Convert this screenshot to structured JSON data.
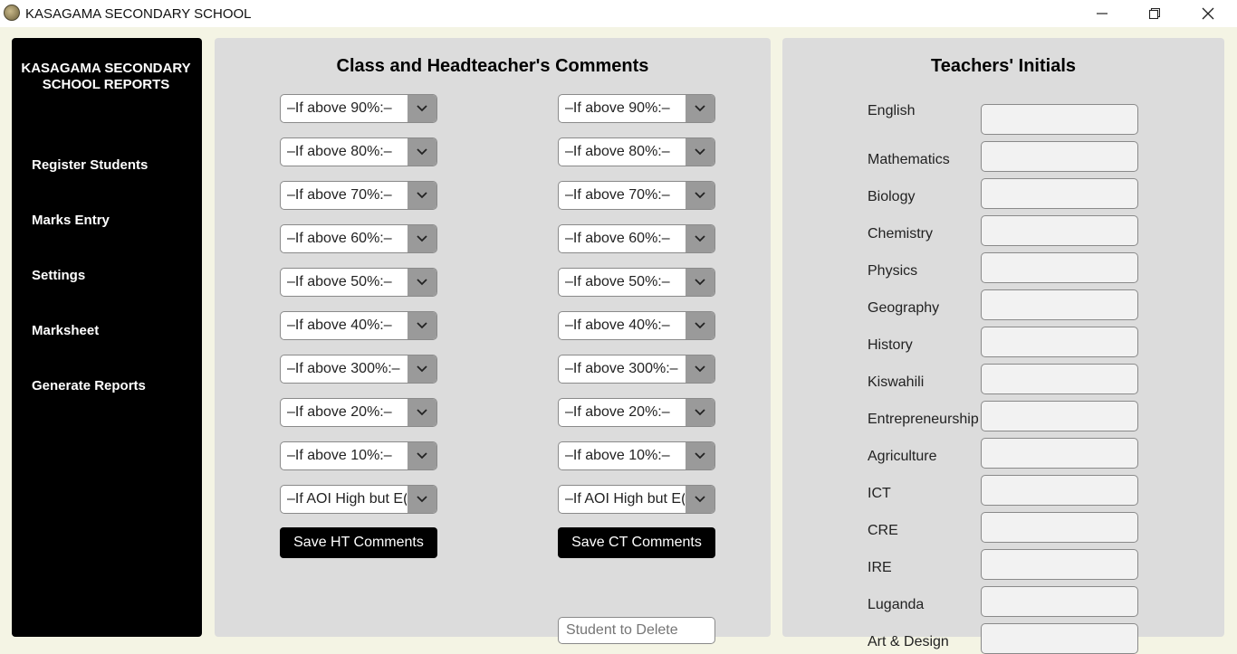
{
  "window": {
    "title": "KASAGAMA SECONDARY SCHOOL",
    "min_icon": "minimize-icon",
    "max_icon": "restore-icon",
    "close_icon": "close-icon"
  },
  "sidebar": {
    "school_name": "KASAGAMA SECONDARY SCHOOL REPORTS",
    "items": [
      {
        "label": "Register Students"
      },
      {
        "label": "Marks Entry"
      },
      {
        "label": "Settings"
      },
      {
        "label": "Marksheet"
      },
      {
        "label": "Generate Reports"
      }
    ]
  },
  "comments": {
    "title": "Class and Headteacher's Comments",
    "ht_column": [
      "–If above 90%:–",
      "–If above 80%:–",
      "–If above 70%:–",
      "–If above 60%:–",
      "–If above 50%:–",
      "–If above 40%:–",
      "–If above 300%:–",
      "–If above 20%:–",
      "–If above 10%:–",
      "–If AOI High but E("
    ],
    "ct_column": [
      "–If above 90%:–",
      "–If above 80%:–",
      "–If above 70%:–",
      "–If above 60%:–",
      "–If above 50%:–",
      "–If above 40%:–",
      "–If above 300%:–",
      "–If above 20%:–",
      "–If above 10%:–",
      "–If AOI High but E("
    ],
    "save_ht_label": "Save HT Comments",
    "save_ct_label": "Save CT Comments",
    "delete_placeholder": "Student to Delete"
  },
  "initials": {
    "title": "Teachers' Initials",
    "subjects": [
      "English",
      "Mathematics",
      "Biology",
      "Chemistry",
      "Physics",
      "Geography",
      "History",
      "Kiswahili",
      "Entrepreneurship",
      "Agriculture",
      "ICT",
      "CRE",
      "IRE",
      "Luganda",
      "Art & Design"
    ]
  },
  "colors": {
    "sidebar_bg": "#000000",
    "panel_bg": "#dcdcdc",
    "window_bg": "#f4f4e4",
    "button_bg": "#000000"
  }
}
